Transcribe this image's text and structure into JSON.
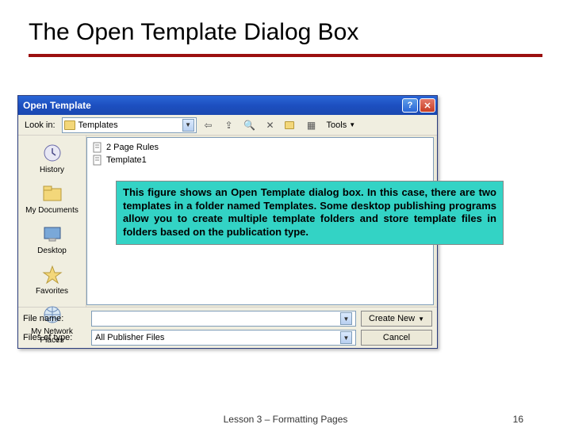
{
  "slide": {
    "title": "The Open Template Dialog Box",
    "footer_center": "Lesson 3 – Formatting Pages",
    "footer_page": "16"
  },
  "dialog": {
    "title": "Open Template",
    "lookin_label": "Look in:",
    "lookin_value": "Templates",
    "tools_label": "Tools",
    "places": [
      {
        "label": "History",
        "icon": "history"
      },
      {
        "label": "My Documents",
        "icon": "folder"
      },
      {
        "label": "Desktop",
        "icon": "desktop"
      },
      {
        "label": "Favorites",
        "icon": "star"
      },
      {
        "label": "My Network Places",
        "icon": "network"
      }
    ],
    "files": [
      {
        "name": "2 Page Rules"
      },
      {
        "name": "Template1"
      }
    ],
    "filename_label": "File name:",
    "filename_value": "",
    "filetype_label": "Files of type:",
    "filetype_value": "All Publisher Files",
    "primary_button": "Create New",
    "cancel_button": "Cancel"
  },
  "callout": {
    "text": "This figure shows an Open Template dialog box. In this case, there are two templates in a folder named Templates. Some desktop publishing programs allow you to create multiple template folders and store template files in folders based on the publication type."
  }
}
